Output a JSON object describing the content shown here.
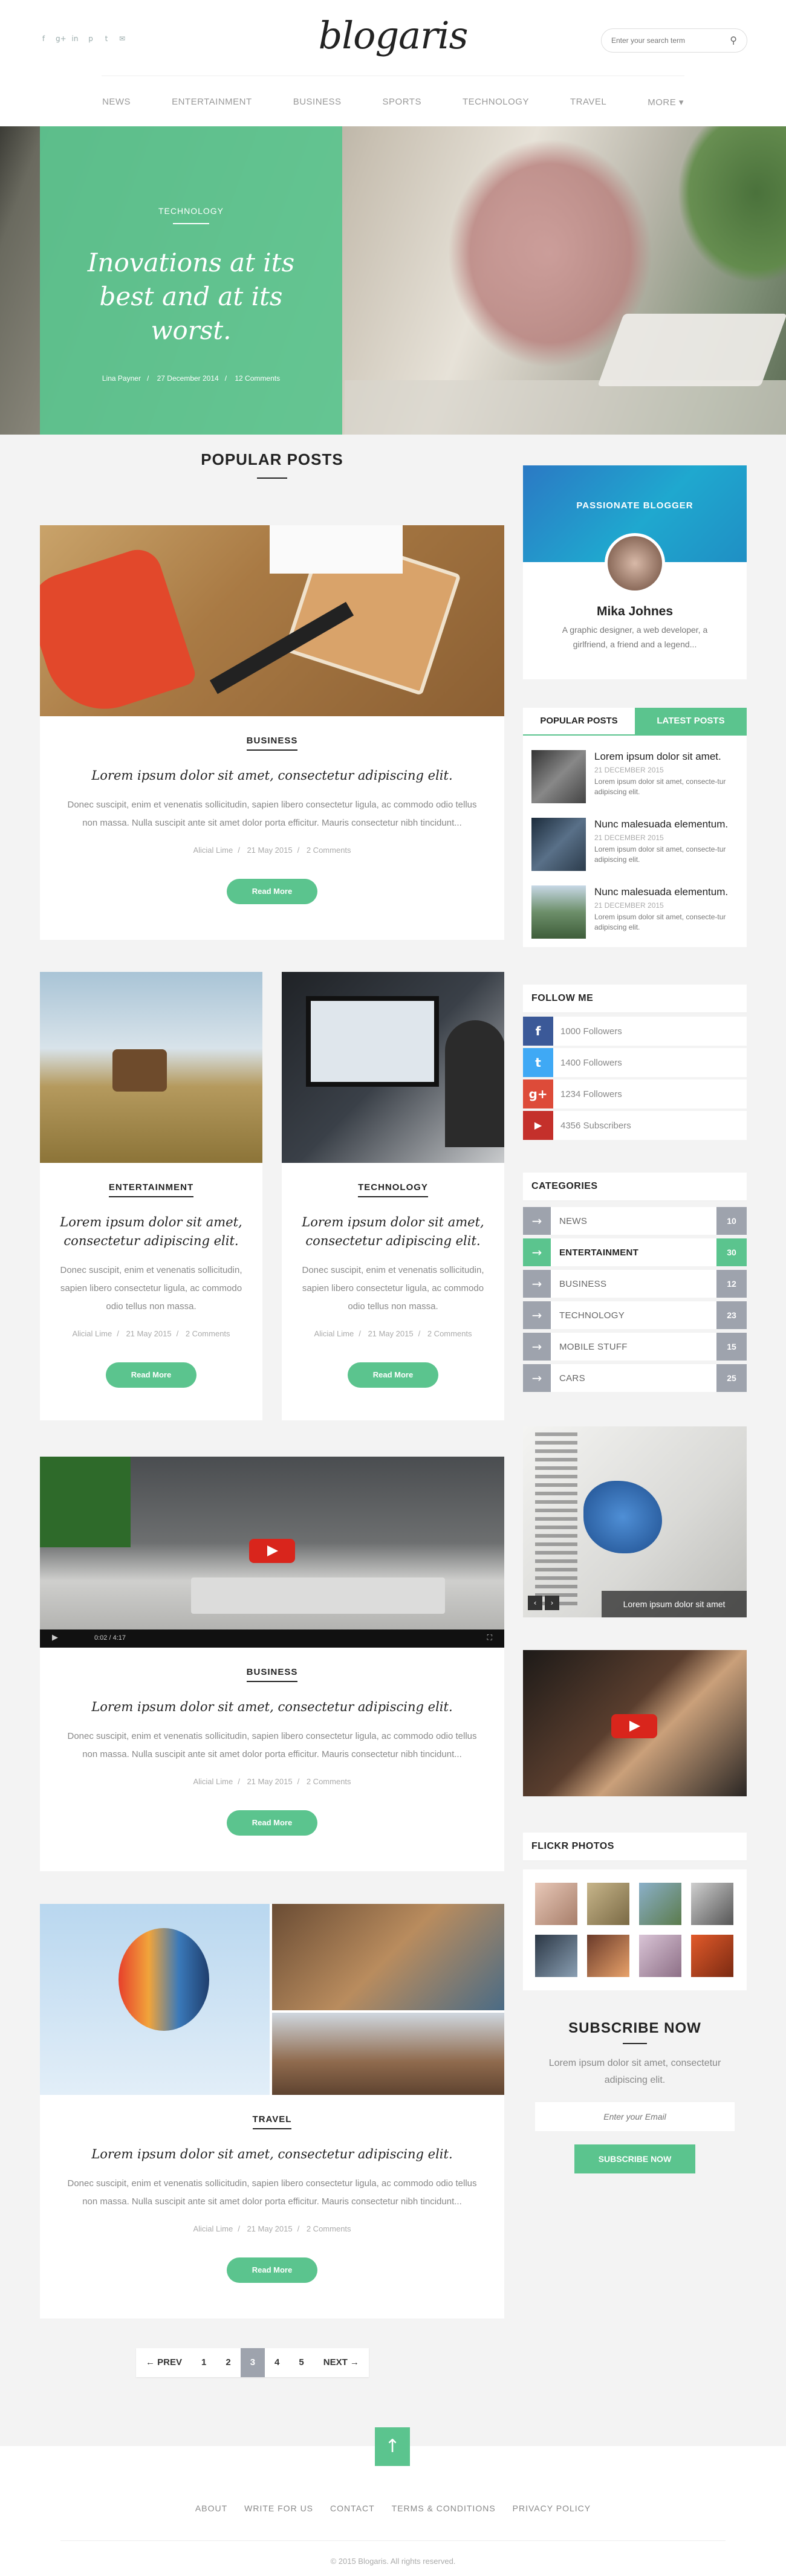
{
  "header": {
    "logo": "blogaris",
    "socials": [
      "f",
      "g+",
      "in",
      "p",
      "t",
      "✉"
    ],
    "search_placeholder": "Enter your search term",
    "nav": [
      "NEWS",
      "ENTERTAINMENT",
      "BUSINESS",
      "SPORTS",
      "TECHNOLOGY",
      "TRAVEL",
      "MORE ▾"
    ]
  },
  "hero": {
    "category": "TECHNOLOGY",
    "title": "Inovations at its best and at its worst.",
    "author": "Lina Payner",
    "date": "27 December 2014",
    "comments": "12 Comments"
  },
  "main": {
    "section_title": "POPULAR POSTS",
    "cards": [
      {
        "category": "BUSINESS",
        "title": "Lorem ipsum dolor sit amet, consectetur adipiscing elit.",
        "text": "Donec suscipit, enim et venenatis sollicitudin, sapien libero consectetur ligula, ac commodo odio tellus non massa. Nulla suscipit ante sit amet dolor porta efficitur. Mauris consectetur nibh tincidunt...",
        "author": "Alicial Lime",
        "date": "21 May 2015",
        "comments": "2 Comments",
        "button": "Read More"
      },
      {
        "category": "ENTERTAINMENT",
        "title": "Lorem ipsum dolor sit amet, consectetur adipiscing elit.",
        "text": "Donec suscipit, enim et venenatis sollicitudin, sapien libero consectetur ligula, ac commodo odio tellus non massa.",
        "author": "Alicial Lime",
        "date": "21 May 2015",
        "comments": "2 Comments",
        "button": "Read More"
      },
      {
        "category": "TECHNOLOGY",
        "title": "Lorem ipsum dolor sit amet, consectetur adipiscing elit.",
        "text": "Donec suscipit, enim et venenatis sollicitudin, sapien libero consectetur ligula, ac commodo odio tellus non massa.",
        "author": "Alicial Lime",
        "date": "21 May 2015",
        "comments": "2 Comments",
        "button": "Read More"
      },
      {
        "category": "BUSINESS",
        "title": "Lorem ipsum dolor sit amet, consectetur adipiscing elit.",
        "text": "Donec suscipit, enim et venenatis sollicitudin, sapien libero consectetur ligula, ac commodo odio tellus non massa. Nulla suscipit ante sit amet dolor porta efficitur. Mauris consectetur nibh tincidunt...",
        "author": "Alicial Lime",
        "date": "21 May 2015",
        "comments": "2 Comments",
        "button": "Read More",
        "video_time": "0:02 / 4:17"
      },
      {
        "category": "TRAVEL",
        "title": "Lorem ipsum dolor sit amet, consectetur adipiscing elit.",
        "text": "Donec suscipit, enim et venenatis sollicitudin, sapien libero consectetur ligula, ac commodo odio tellus non massa. Nulla suscipit ante sit amet dolor porta efficitur. Mauris consectetur nibh tincidunt...",
        "author": "Alicial Lime",
        "date": "21 May 2015",
        "comments": "2 Comments",
        "button": "Read More"
      }
    ]
  },
  "sidebar": {
    "profile": {
      "heading": "PASSIONATE BLOGGER",
      "name": "Mika Johnes",
      "bio": "A graphic designer, a web developer, a girlfriend, a friend and a legend..."
    },
    "tabs": [
      "POPULAR POSTS",
      "LATEST POSTS"
    ],
    "latest": [
      {
        "title": "Lorem ipsum dolor sit amet.",
        "date": "21 DECEMBER 2015",
        "text": "Lorem ipsum dolor sit amet, consecte-tur adipiscing elit."
      },
      {
        "title": "Nunc malesuada elementum.",
        "date": "21 DECEMBER 2015",
        "text": "Lorem ipsum dolor sit amet, consecte-tur adipiscing elit."
      },
      {
        "title": "Nunc malesuada elementum.",
        "date": "21 DECEMBER 2015",
        "text": "Lorem ipsum dolor sit amet, consecte-tur adipiscing elit."
      }
    ],
    "follow_title": "FOLLOW ME",
    "follow": [
      {
        "icon": "f",
        "label": "1000 Followers",
        "color": "#3b5998"
      },
      {
        "icon": "t",
        "label": "1400 Followers",
        "color": "#3fa9f5"
      },
      {
        "icon": "g+",
        "label": "1234 Followers",
        "color": "#dd4b39"
      },
      {
        "icon": "▶",
        "label": "4356 Subscribers",
        "color": "#c4302b"
      }
    ],
    "categories_title": "CATEGORIES",
    "categories": [
      {
        "name": "NEWS",
        "count": "10"
      },
      {
        "name": "ENTERTAINMENT",
        "count": "30"
      },
      {
        "name": "BUSINESS",
        "count": "12"
      },
      {
        "name": "TECHNOLOGY",
        "count": "23"
      },
      {
        "name": "MOBILE STUFF",
        "count": "15"
      },
      {
        "name": "CARS",
        "count": "25"
      }
    ],
    "slider_caption": "Lorem ipsum dolor sit amet",
    "flickr_title": "FLICKR PHOTOS",
    "subscribe": {
      "title": "SUBSCRIBE NOW",
      "text": "Lorem ipsum dolor sit amet, consectetur adipiscing elit.",
      "placeholder": "Enter your Email",
      "button": "SUBSCRIBE NOW"
    }
  },
  "pagination": {
    "prev": "← PREV",
    "pages": [
      "1",
      "2",
      "3",
      "4",
      "5"
    ],
    "next": "NEXT →",
    "current": "3"
  },
  "footer": {
    "links": [
      "ABOUT",
      "WRITE FOR US",
      "CONTACT",
      "TERMS & CONDITIONS",
      "PRIVACY POLICY"
    ],
    "copyright": "© 2015 Blogaris. All rights reserved."
  }
}
